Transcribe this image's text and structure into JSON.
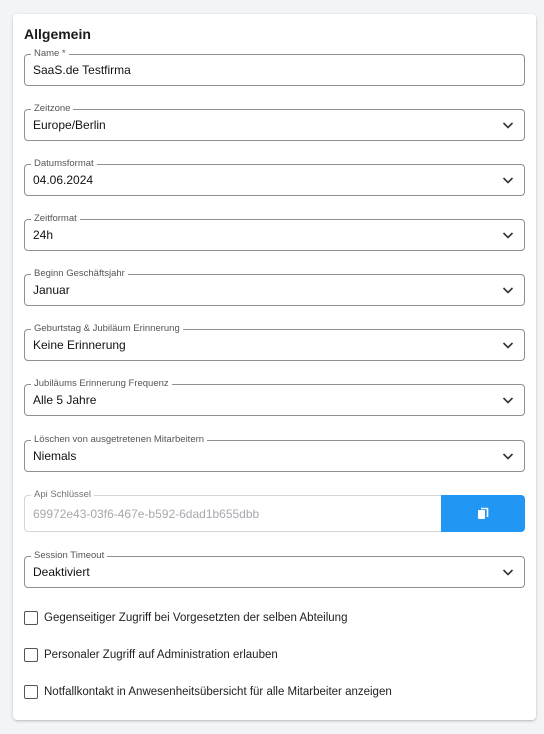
{
  "section": {
    "title": "Allgemein"
  },
  "fields": {
    "name": {
      "label": "Name *",
      "value": "SaaS.de Testfirma"
    },
    "timezone": {
      "label": "Zeitzone",
      "value": "Europe/Berlin"
    },
    "date_format": {
      "label": "Datumsformat",
      "value": "04.06.2024"
    },
    "time_format": {
      "label": "Zeitformat",
      "value": "24h"
    },
    "fiscal_year_start": {
      "label": "Beginn Geschäftsjahr",
      "value": "Januar"
    },
    "birthday_reminder": {
      "label": "Geburtstag & Jubiläum Erinnerung",
      "value": "Keine Erinnerung"
    },
    "anniversary_frequency": {
      "label": "Jubiläums Erinnerung Frequenz",
      "value": "Alle 5 Jahre"
    },
    "delete_former_employees": {
      "label": "Löschen von ausgetretenen Mitarbeitern",
      "value": "Niemals"
    },
    "api_key": {
      "label": "Api Schlüssel",
      "value": "69972e43-03f6-467e-b592-6dad1b655dbb"
    },
    "session_timeout": {
      "label": "Session Timeout",
      "value": "Deaktiviert"
    }
  },
  "checkboxes": [
    {
      "label": "Gegenseitiger Zugriff bei Vorgesetzten der selben Abteilung",
      "checked": false
    },
    {
      "label": "Personaler Zugriff auf Administration erlauben",
      "checked": false
    },
    {
      "label": "Notfallkontakt in Anwesenheitsübersicht für alle Mitarbeiter anzeigen",
      "checked": false
    }
  ],
  "icons": {
    "select": "chevron-down-icon",
    "copy": "copy-icon"
  },
  "colors": {
    "accent": "#2196f3",
    "border": "#8c8f93"
  }
}
